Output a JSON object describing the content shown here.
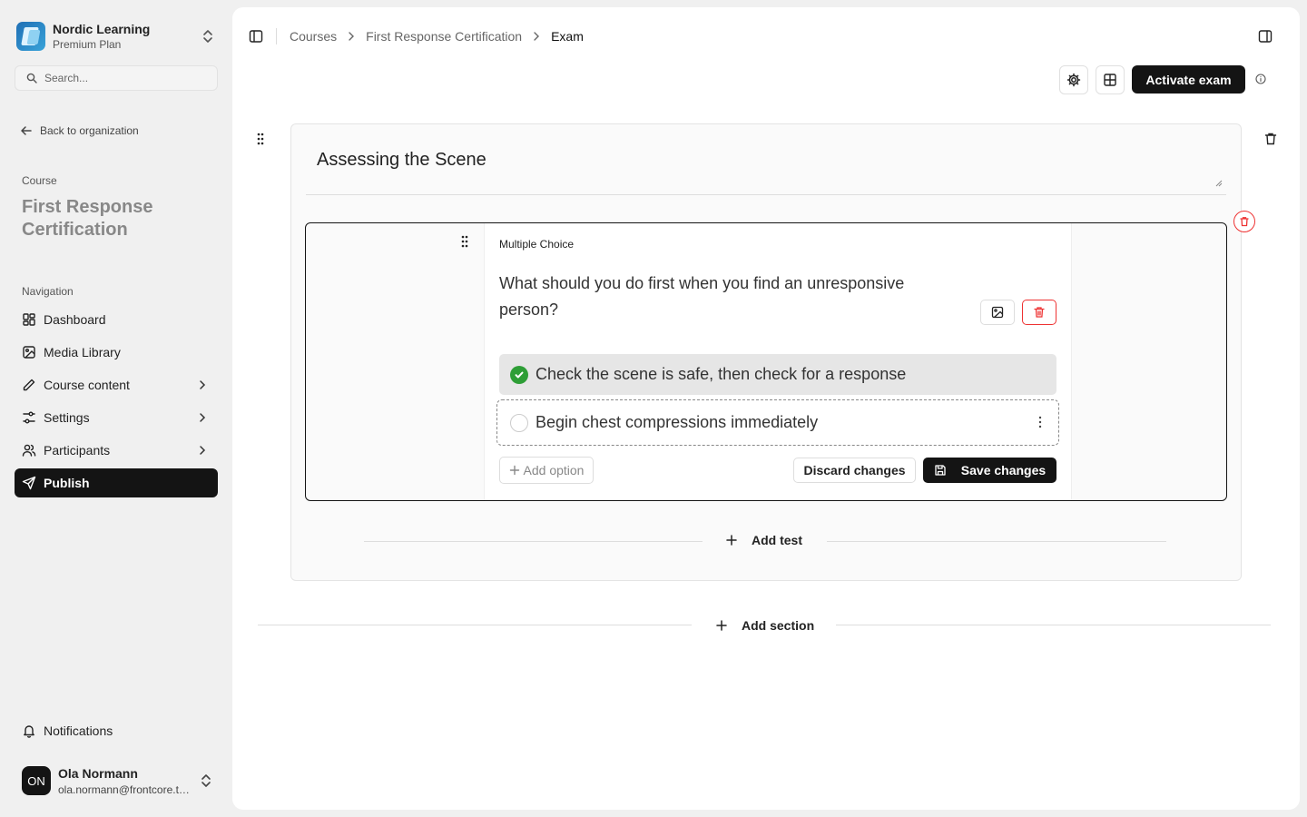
{
  "org": {
    "name": "Nordic Learning",
    "plan": "Premium Plan"
  },
  "search": {
    "placeholder": "Search..."
  },
  "back_link": "Back to organization",
  "course": {
    "label": "Course",
    "title": "First Response Certification"
  },
  "navigation": {
    "label": "Navigation",
    "items": [
      {
        "label": "Dashboard",
        "icon": "dashboard-icon"
      },
      {
        "label": "Media Library",
        "icon": "image-icon"
      },
      {
        "label": "Course content",
        "icon": "pencil-icon",
        "has_children": true
      },
      {
        "label": "Settings",
        "icon": "sliders-icon",
        "has_children": true
      },
      {
        "label": "Participants",
        "icon": "users-icon",
        "has_children": true
      },
      {
        "label": "Publish",
        "icon": "send-icon",
        "active": true
      }
    ]
  },
  "notifications_label": "Notifications",
  "user": {
    "initials": "ON",
    "name": "Ola Normann",
    "email": "ola.normann@frontcore.tech"
  },
  "breadcrumb": [
    "Courses",
    "First Response Certification",
    "Exam"
  ],
  "toolbar": {
    "activate_label": "Activate exam"
  },
  "section": {
    "title": "Assessing the Scene",
    "question": {
      "type": "Multiple Choice",
      "text": "What should you do first when you find an unresponsive person?",
      "options": [
        {
          "text": "Check the scene is safe, then check for a response",
          "correct": true
        },
        {
          "text": "Begin chest compressions immediately",
          "correct": false,
          "editing": true
        }
      ],
      "add_option_label": "Add option",
      "discard_label": "Discard changes",
      "save_label": "Save changes"
    },
    "add_test_label": "Add test"
  },
  "add_section_label": "Add section",
  "colors": {
    "primary": "#141414",
    "correct": "#2e9e36",
    "danger": "#e33333",
    "sidebar_bg": "#f0f0f0"
  }
}
